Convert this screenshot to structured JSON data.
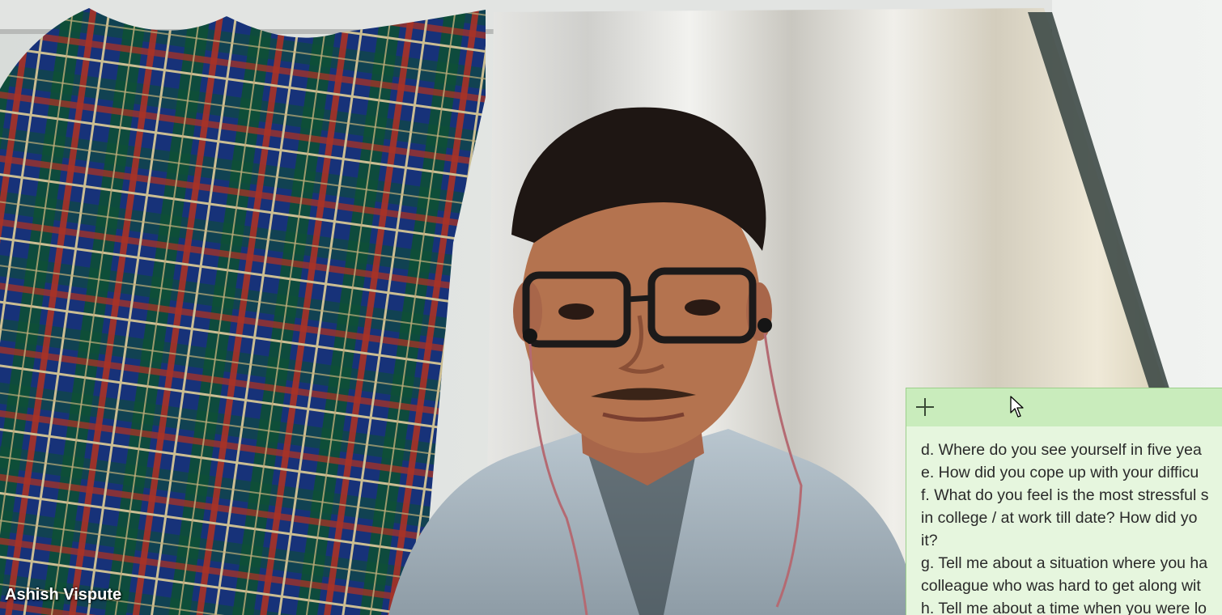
{
  "participant": {
    "name": "Ashish Vispute"
  },
  "sticky_note": {
    "add_icon": "plus-icon",
    "lines": [
      "d. Where do you see yourself in  five yea",
      "e. How did you cope up with your difficu",
      "f. What do you feel is the most stressful s",
      "in college / at work till date? How did yo",
      "it?",
      "g. Tell me about a situation where you ha",
      "colleague who was hard to get along wit",
      "h. Tell me about a time when you were lo"
    ]
  },
  "colors": {
    "note_background": "#e6f6de",
    "note_header": "#c9ecbc",
    "name_text": "#ffffff"
  }
}
